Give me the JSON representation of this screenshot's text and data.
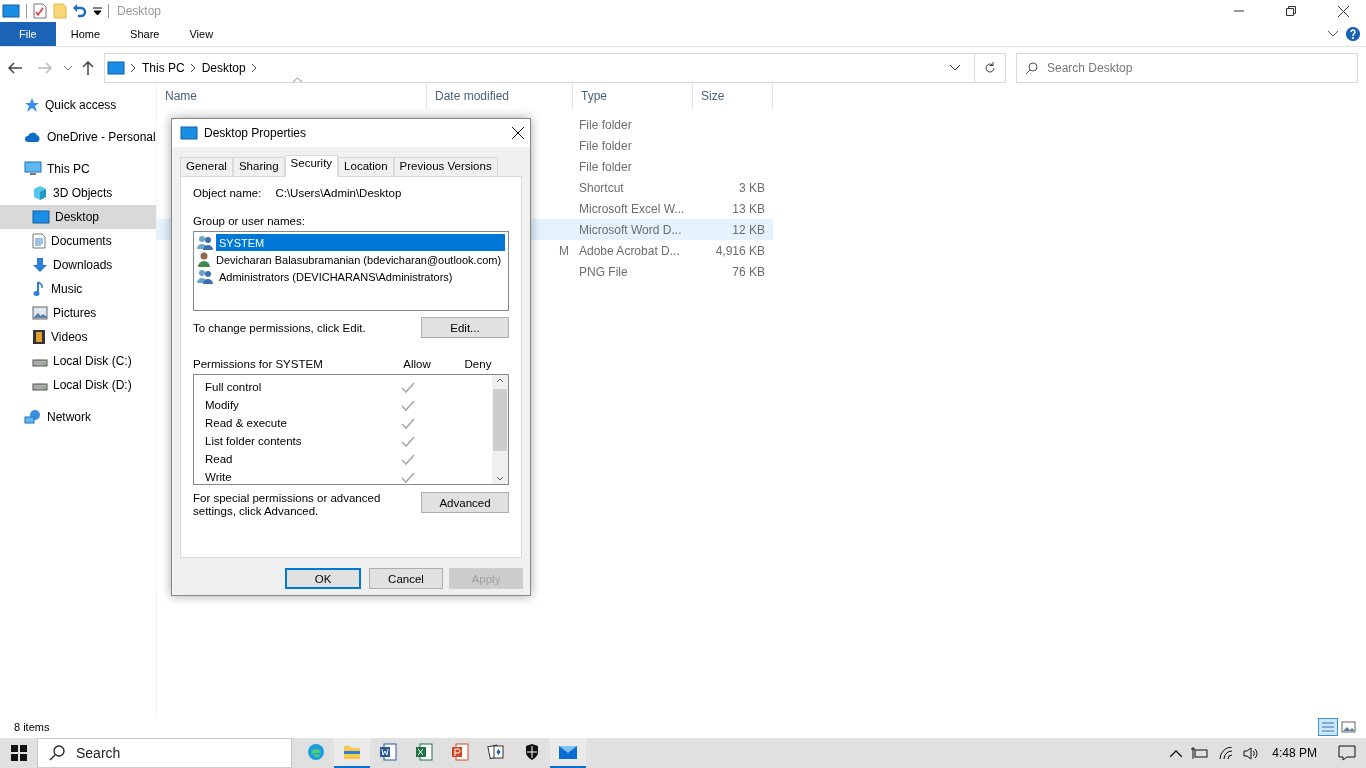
{
  "window": {
    "title": "Desktop"
  },
  "ribbon_tabs": [
    {
      "label": "File",
      "kind": "file"
    },
    {
      "label": "Home",
      "kind": "tab"
    },
    {
      "label": "Share",
      "kind": "tab"
    },
    {
      "label": "View",
      "kind": "tab"
    }
  ],
  "address": {
    "crumbs": [
      "This PC",
      "Desktop"
    ]
  },
  "search": {
    "placeholder": "Search Desktop"
  },
  "sidebar": {
    "items": [
      {
        "label": "Quick access",
        "kind": "star",
        "selected": false
      },
      {
        "label": "OneDrive - Personal",
        "kind": "cloud",
        "selected": false
      },
      {
        "label": "This PC",
        "kind": "pc",
        "selected": false,
        "children": [
          {
            "label": "3D Objects",
            "kind": "cube",
            "selected": false
          },
          {
            "label": "Desktop",
            "kind": "desktop",
            "selected": true
          },
          {
            "label": "Documents",
            "kind": "doc",
            "selected": false
          },
          {
            "label": "Downloads",
            "kind": "download",
            "selected": false
          },
          {
            "label": "Music",
            "kind": "music",
            "selected": false
          },
          {
            "label": "Pictures",
            "kind": "pictures",
            "selected": false
          },
          {
            "label": "Videos",
            "kind": "film",
            "selected": false
          },
          {
            "label": "Local Disk (C:)",
            "kind": "disk",
            "selected": false
          },
          {
            "label": "Local Disk (D:)",
            "kind": "disk",
            "selected": false
          }
        ]
      },
      {
        "label": "Network",
        "kind": "network",
        "selected": false
      }
    ]
  },
  "table": {
    "columns": [
      "Name",
      "Date modified",
      "Type",
      "Size"
    ],
    "rows": [
      {
        "type": "File folder",
        "selected": false
      },
      {
        "type": "File folder",
        "selected": false
      },
      {
        "type": "File folder",
        "selected": false
      },
      {
        "type": "Shortcut",
        "size": "3 KB",
        "selected": false
      },
      {
        "type": "Microsoft Excel W...",
        "size": "13 KB",
        "selected": false
      },
      {
        "type": "Microsoft Word D...",
        "size": "12 KB",
        "selected": true
      },
      {
        "date": "M",
        "type": "Adobe Acrobat D...",
        "size": "4,916 KB",
        "selected": false
      },
      {
        "type": "PNG File",
        "size": "76 KB",
        "selected": false
      }
    ]
  },
  "status_bar": {
    "text": "8 items"
  },
  "dialog": {
    "title": "Desktop Properties",
    "tabs": [
      {
        "label": "General",
        "selected": false
      },
      {
        "label": "Sharing",
        "selected": false
      },
      {
        "label": "Security",
        "selected": true
      },
      {
        "label": "Location",
        "selected": false
      },
      {
        "label": "Previous Versions",
        "selected": false
      }
    ],
    "object_label": "Object name:",
    "object_value": "C:\\Users\\Admin\\Desktop",
    "group_label": "Group or user names:",
    "users": [
      {
        "name": "SYSTEM",
        "kind": "group",
        "selected": true
      },
      {
        "name": "Devicharan Balasubramanian (bdevicharan@outlook.com)",
        "kind": "user",
        "selected": false
      },
      {
        "name": "Administrators (DEVICHARANS\\Administrators)",
        "kind": "group",
        "selected": false
      }
    ],
    "change_note": "To change permissions, click Edit.",
    "edit_button": "Edit...",
    "permissions_label": "Permissions for SYSTEM",
    "allow_label": "Allow",
    "deny_label": "Deny",
    "permissions": [
      {
        "name": "Full control",
        "allow": true
      },
      {
        "name": "Modify",
        "allow": true
      },
      {
        "name": "Read & execute",
        "allow": true
      },
      {
        "name": "List folder contents",
        "allow": true
      },
      {
        "name": "Read",
        "allow": true
      },
      {
        "name": "Write",
        "allow": true
      }
    ],
    "advanced_note": "For special permissions or advanced settings, click Advanced.",
    "advanced_button": "Advanced",
    "buttons": [
      {
        "label": "OK",
        "kind": "default",
        "disabled": false
      },
      {
        "label": "Cancel",
        "kind": "normal",
        "disabled": false
      },
      {
        "label": "Apply",
        "kind": "normal",
        "disabled": true
      }
    ]
  },
  "taskbar": {
    "search_placeholder": "Search",
    "apps": [
      {
        "kind": "edge",
        "active": false
      },
      {
        "kind": "explorer",
        "active": true
      },
      {
        "kind": "word",
        "active": false
      },
      {
        "kind": "excel",
        "active": false
      },
      {
        "kind": "powerpoint",
        "active": false
      },
      {
        "kind": "cards",
        "active": false
      },
      {
        "kind": "shield",
        "active": false
      },
      {
        "kind": "mail",
        "active": true
      }
    ],
    "time": "4:48 PM"
  }
}
